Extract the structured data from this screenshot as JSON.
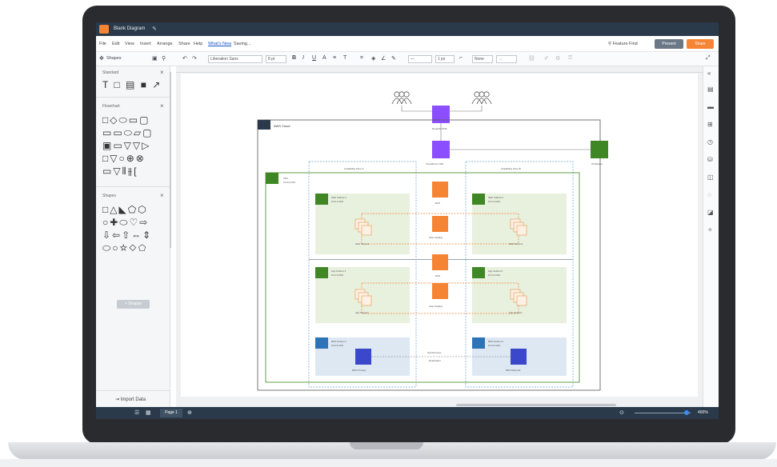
{
  "window": {
    "doc_title": "Blank Diagram"
  },
  "menu": {
    "items": [
      "File",
      "Edit",
      "View",
      "Insert",
      "Arrange",
      "Share",
      "Help"
    ],
    "whats_new": "What's New",
    "saving": "Saving..."
  },
  "header_actions": {
    "feature_find": "Feature Find",
    "present": "Present",
    "share": "Share"
  },
  "toolbar": {
    "font": "Liberation Sans",
    "font_size": "8 pt",
    "line_width": "1 px",
    "arrow": "None"
  },
  "sidebar": {
    "header": "Shapes",
    "panels": [
      {
        "title": "Standard",
        "rows": [
          "T □ ▤ ■ ↗"
        ]
      },
      {
        "title": "Flowchart",
        "rows": [
          "□◇⬭▭▢",
          "▭▭⬭▱▢",
          "▣▭▽▽▷",
          "□▽○⊕⊗",
          "▭▽⫴⫵["
        ]
      },
      {
        "title": "Shapes",
        "rows": [
          "□△◣⬠⬡",
          "○✚⬭♡⇨",
          "⇩⇦⇧⇔⇕",
          "⬭○☆◇⬠"
        ]
      }
    ],
    "add_shapes": "+ Shapes",
    "import_data": "Import Data"
  },
  "bottom": {
    "page_tab": "Page 1",
    "zoom": "400%"
  },
  "diagram": {
    "aws_cloud": "AWS Cloud",
    "vpc": "VPC",
    "vpc_cidr": "10.0.0.0/16",
    "route53": "Route53 DNS",
    "cloudfront": "CloudFront CDN",
    "s3": "S3 Bucket",
    "az_a": "Availability Zone A",
    "az_b": "Availability Zone B",
    "elb": "ELB",
    "auto_scaling": "Auto Scaling",
    "web_subnet_1": "Web Subnet 1",
    "web_subnet_1_cidr": "10.0.1.0/24",
    "web_subnet_2": "Web Subnet 2",
    "web_subnet_2_cidr": "10.0.2.0/24",
    "app_subnet_1": "App Subnet 1",
    "app_subnet_1_cidr": "10.0.3.0/24",
    "app_subnet_2": "App Subnet 2",
    "app_subnet_2_cidr": "10.0.4.0/24",
    "rds_subnet_1": "RDS Subnet 1",
    "rds_subnet_1_cidr": "10.0.5.0/24",
    "rds_subnet_2": "RDS Subnet 2",
    "rds_subnet_2_cidr": "10.0.6.0/24",
    "web_servers": "Web Servers",
    "app_servers": "App Servers",
    "rds_primary": "RDS Primary",
    "rds_multi_az": "RDS Multi-AZ",
    "replication_1": "Synchronous",
    "replication_2": "Replication"
  },
  "colors": {
    "orange": "#f58534",
    "purple": "#8c4fff",
    "green_aws": "#3f8624",
    "blue_rds": "#3b48cc",
    "navy": "#2b3a4a"
  }
}
